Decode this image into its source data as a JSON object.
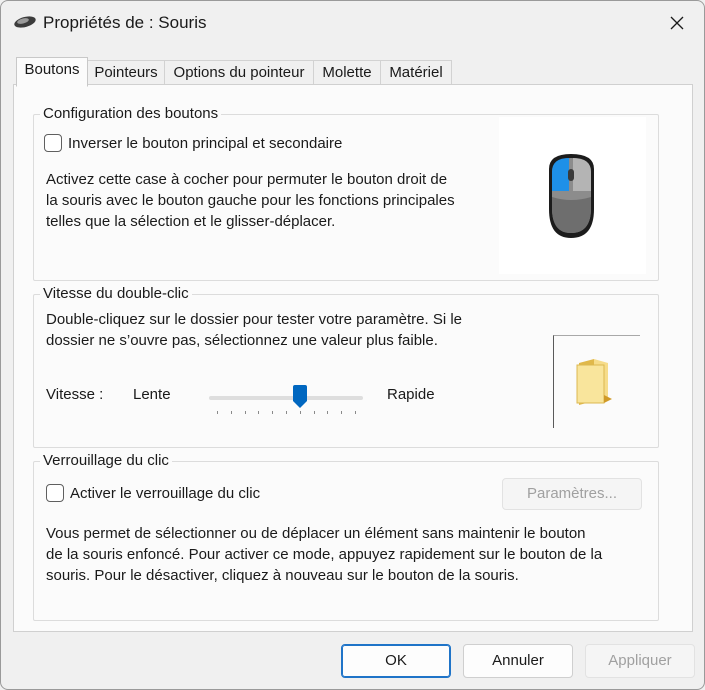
{
  "window": {
    "title": "Propriétés de : Souris"
  },
  "tabs": [
    {
      "label": "Boutons",
      "active": true
    },
    {
      "label": "Pointeurs"
    },
    {
      "label": "Options du pointeur"
    },
    {
      "label": "Molette"
    },
    {
      "label": "Matériel"
    }
  ],
  "button_config": {
    "group_title": "Configuration des boutons",
    "swap_checkbox_label": "Inverser le bouton principal et secondaire",
    "swap_checked": false,
    "description": [
      "Activez cette case à cocher pour permuter le bouton droit de",
      "la souris avec le bouton gauche pour les fonctions principales",
      "telles que la sélection et le glisser-déplacer."
    ]
  },
  "double_click": {
    "group_title": "Vitesse du double-clic",
    "description": [
      "Double-cliquez sur le dossier pour tester votre paramètre. Si le",
      "dossier ne s’ouvre pas, sélectionnez une valeur plus faible."
    ],
    "speed_label": "Vitesse :",
    "slow_label": "Lente",
    "fast_label": "Rapide",
    "slider_value": 0.6,
    "tick_count": 11
  },
  "click_lock": {
    "group_title": "Verrouillage du clic",
    "checkbox_label": "Activer le verrouillage du clic",
    "checked": false,
    "settings_button": "Paramètres...",
    "description": [
      "Vous permet de sélectionner ou de déplacer un élément sans maintenir le bouton",
      "de la souris enfoncé. Pour activer ce mode, appuyez rapidement sur le bouton de la",
      "souris. Pour le désactiver, cliquez à nouveau sur le bouton de la souris."
    ]
  },
  "footer": {
    "ok": "OK",
    "cancel": "Annuler",
    "apply": "Appliquer"
  },
  "colors": {
    "accent": "#0067c0",
    "mouse_primary": "#1e90e8"
  }
}
